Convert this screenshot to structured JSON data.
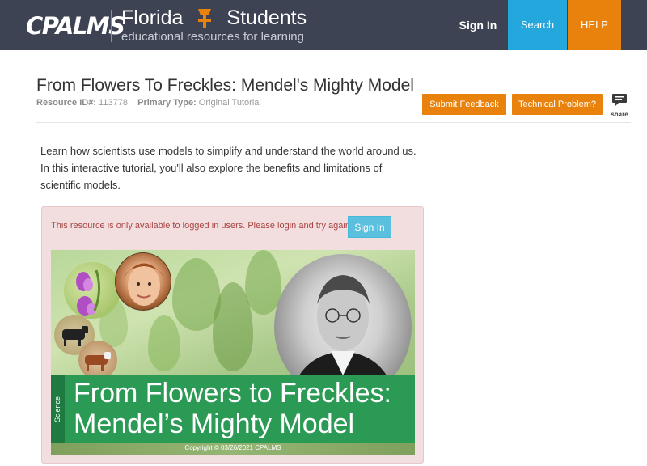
{
  "header": {
    "logo_text": "CPALMS",
    "brand_title_left": "Florida",
    "brand_title_right": "Students",
    "brand_subtitle": "educational resources for learning",
    "nav": {
      "sign_in": "Sign In",
      "search": "Search",
      "help": "HELP"
    }
  },
  "resource": {
    "title": "From Flowers To Freckles: Mendel's Mighty Model",
    "id_label": "Resource ID#:",
    "id_value": "113778",
    "type_label": "Primary Type:",
    "type_value": "Original Tutorial",
    "buttons": {
      "submit_feedback": "Submit Feedback",
      "technical_problem": "Technical Problem?",
      "share": "share"
    },
    "description": "Learn how scientists use models to simplify and understand the world around us. In this interactive tutorial, you'll also explore the benefits and limitations of scientific models."
  },
  "login_panel": {
    "message": "This resource is only available to logged in users. Please login and try again.",
    "sign_in": "Sign In"
  },
  "banner": {
    "subject": "Science",
    "title_line1": "From Flowers to Freckles:",
    "title_line2": "Mendel’s Mighty Model",
    "copyright": "Copyright © 03/26/2021 CPALMS"
  },
  "colors": {
    "header_bg": "#3d4352",
    "search_bg": "#23a7dd",
    "help_bg": "#e8820c",
    "orange_button": "#e8820c",
    "alert_bg": "#f2dede",
    "alert_text": "#a94442",
    "info_button": "#5bc0de",
    "banner_green": "#2b9a55"
  },
  "icons": {
    "brand": "torch-icon",
    "share": "speech-bubble-icon"
  }
}
